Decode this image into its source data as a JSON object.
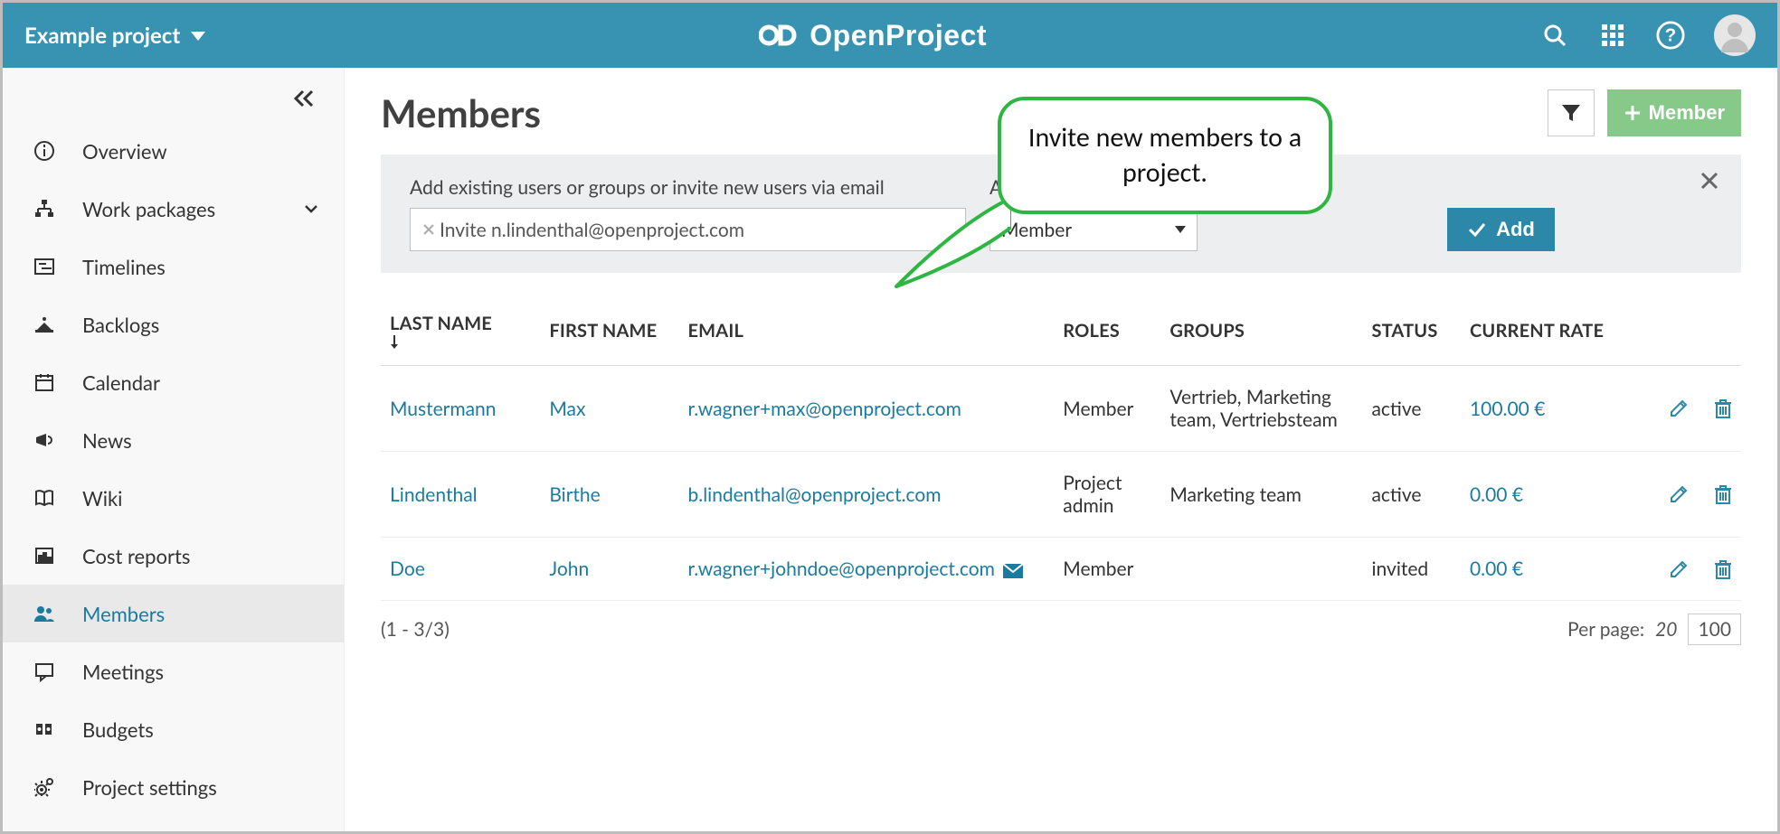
{
  "header": {
    "project_name": "Example project",
    "brand": "OpenProject"
  },
  "sidebar": {
    "items": [
      {
        "label": "Overview"
      },
      {
        "label": "Work packages"
      },
      {
        "label": "Timelines"
      },
      {
        "label": "Backlogs"
      },
      {
        "label": "Calendar"
      },
      {
        "label": "News"
      },
      {
        "label": "Wiki"
      },
      {
        "label": "Cost reports"
      },
      {
        "label": "Members"
      },
      {
        "label": "Meetings"
      },
      {
        "label": "Budgets"
      },
      {
        "label": "Project settings"
      }
    ]
  },
  "page": {
    "title": "Members",
    "member_button": "Member"
  },
  "invite": {
    "users_label": "Add existing users or groups or invite new users via email",
    "chip_text": "Invite n.lindenthal@openproject.com",
    "role_label": "Assign role to new members",
    "role_value": "Member",
    "add_button": "Add"
  },
  "callout": {
    "text": "Invite new members to a project."
  },
  "table": {
    "columns": {
      "last_name": "LAST NAME",
      "first_name": "FIRST NAME",
      "email": "EMAIL",
      "roles": "ROLES",
      "groups": "GROUPS",
      "status": "STATUS",
      "rate": "CURRENT RATE"
    },
    "rows": [
      {
        "last_name": "Mustermann",
        "first_name": "Max",
        "email": "r.wagner+max@openproject.com",
        "roles": "Member",
        "groups": "Vertrieb, Marketing team, Vertriebsteam",
        "status": "active",
        "rate": "100.00 €",
        "has_mail_icon": false
      },
      {
        "last_name": "Lindenthal",
        "first_name": "Birthe",
        "email": "b.lindenthal@openproject.com",
        "roles": "Project admin",
        "groups": "Marketing team",
        "status": "active",
        "rate": "0.00 €",
        "has_mail_icon": false
      },
      {
        "last_name": "Doe",
        "first_name": "John",
        "email": "r.wagner+johndoe@openproject.com",
        "roles": "Member",
        "groups": "",
        "status": "invited",
        "rate": "0.00 €",
        "has_mail_icon": true
      }
    ],
    "footer": {
      "range": "(1 - 3/3)",
      "per_page_label": "Per page:",
      "per_page_current": "20",
      "per_page_other": "100"
    }
  }
}
